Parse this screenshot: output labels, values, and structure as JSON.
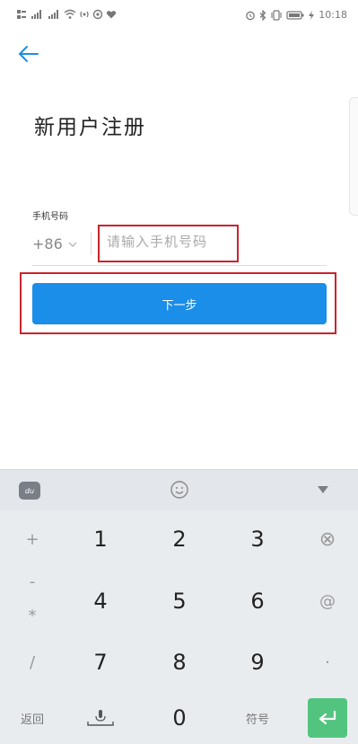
{
  "status_bar": {
    "left_icons": [
      "sim-icon",
      "signal-icon",
      "signal-icon",
      "wifi-icon",
      "hotspot-icon",
      "app-icon",
      "heart-icon"
    ],
    "right_icons": [
      "alarm-icon",
      "bluetooth-icon",
      "vibrate-icon",
      "battery-icon",
      "charging-icon"
    ],
    "time": "10:18"
  },
  "header": {
    "back_icon": "arrow-left-icon"
  },
  "page": {
    "title": "新用户注册",
    "phone_label": "手机号码",
    "country_code": "+86",
    "phone_placeholder": "请输入手机号码",
    "next_button": "下一步"
  },
  "colors": {
    "accent": "#1a8ee8",
    "highlight_border": "#c9242b",
    "enter_key": "#53c47f"
  },
  "keyboard": {
    "toolbar": {
      "logo": "du",
      "emoji_icon": "smiley-icon",
      "collapse_icon": "triangle-down-icon"
    },
    "rows": [
      {
        "side": "+",
        "keys": [
          "1",
          "2",
          "3"
        ],
        "right": "⊗"
      },
      {
        "side": "-",
        "side2": "*",
        "keys": [
          "4",
          "5",
          "6"
        ],
        "right": "@"
      },
      {
        "side": "/",
        "keys": [
          "7",
          "8",
          "9"
        ],
        "right": "·"
      }
    ],
    "bottom": {
      "back": "返回",
      "mic_icon": "microphone-icon",
      "zero": "0",
      "symbols": "符号",
      "enter_icon": "enter-icon"
    }
  }
}
